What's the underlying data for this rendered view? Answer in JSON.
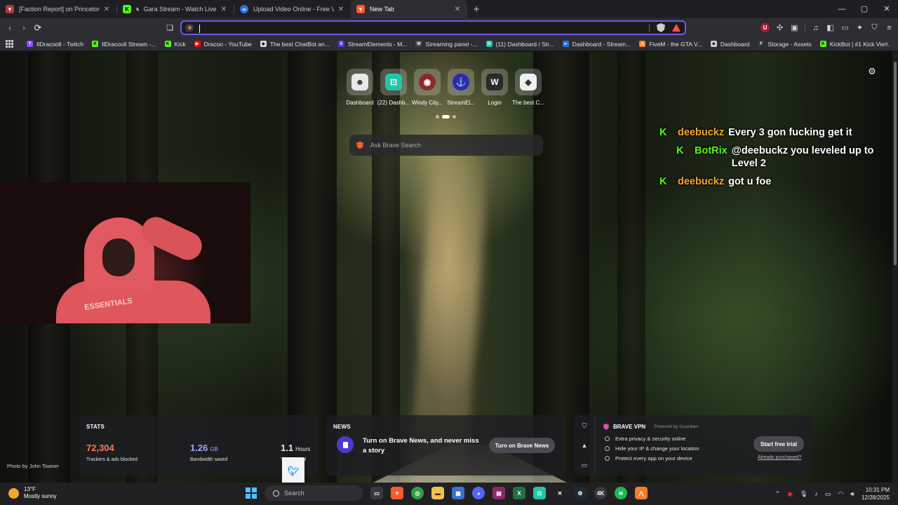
{
  "tabs": [
    {
      "title": "[Faction Report] on PrincetonBlock /",
      "favicon": "lion-icon",
      "color": "#b23b3b",
      "active": false,
      "muted": false
    },
    {
      "title": "Gara Stream - Watch Live on",
      "favicon": "kick-icon",
      "color": "#53fc18",
      "active": false,
      "muted": true
    },
    {
      "title": "Upload Video Online - Free Video H",
      "favicon": "upload-icon",
      "color": "#2f6fe0",
      "active": false,
      "muted": false
    },
    {
      "title": "New Tab",
      "favicon": "brave-icon",
      "color": "#ff5a2e",
      "active": true,
      "muted": false
    }
  ],
  "window_controls": {
    "minimize": "—",
    "maximize": "▢",
    "close": "✕"
  },
  "toolbar": {
    "back": "‹",
    "forward": "›",
    "reload": "⟳",
    "bookmark": "☐",
    "url_value": "",
    "url_placeholder": ""
  },
  "bookmarks": [
    {
      "label": "IlDracooll - Twitch",
      "icon": "twitch-icon",
      "color": "#9146ff"
    },
    {
      "label": "IlDracooll Stream -...",
      "icon": "kick-icon",
      "color": "#53fc18"
    },
    {
      "label": "Kick",
      "icon": "kick-icon",
      "color": "#53fc18"
    },
    {
      "label": "Dracoo - YouTube",
      "icon": "youtube-icon",
      "color": "#ff0000"
    },
    {
      "label": "The best ChatBot an...",
      "icon": "chatbot-icon",
      "color": "#dddddd"
    },
    {
      "label": "StreamElements - M...",
      "icon": "streamelements-icon",
      "color": "#4b3ad8"
    },
    {
      "label": "Streaming panel -...",
      "icon": "w-icon",
      "color": "#444444"
    },
    {
      "label": "(11) Dashboard / Str...",
      "icon": "dashboard-icon",
      "color": "#1fc7a8"
    },
    {
      "label": "Dashboard - Stream...",
      "icon": "stream-icon",
      "color": "#2f6fe0"
    },
    {
      "label": "FiveM - the GTA V...",
      "icon": "fivem-icon",
      "color": "#f27e2a"
    },
    {
      "label": "Dashboard",
      "icon": "bot-icon",
      "color": "#cccccc"
    },
    {
      "label": "Storage - Assets",
      "icon": "f-icon",
      "color": "#333333"
    },
    {
      "label": "KickBot | #1 Kick Vie...",
      "icon": "kick-icon",
      "color": "#53fc18"
    }
  ],
  "top_sites": [
    {
      "label": "Dashboard",
      "icon": "bot-icon",
      "color": "#e8e8e8",
      "glyph": "☻"
    },
    {
      "label": "(22) Dashb...",
      "icon": "dashboard-icon",
      "color": "#1fc7a8",
      "glyph": "⊡"
    },
    {
      "label": "Windy City...",
      "icon": "windy-city-icon",
      "color": "#8a2a2a",
      "glyph": "◉"
    },
    {
      "label": "StreamEl...",
      "icon": "streamelements-icon",
      "color": "#2b2bb0",
      "glyph": "⚓"
    },
    {
      "label": "Login",
      "icon": "w-icon",
      "color": "#2a2a2a",
      "glyph": "W"
    },
    {
      "label": "The best C...",
      "icon": "chatbot-icon",
      "color": "#f0f0f0",
      "glyph": "◆"
    }
  ],
  "search": {
    "placeholder": "Ask Brave Search"
  },
  "chat": [
    {
      "user": "deebuckz",
      "user_color": "#f5a623",
      "message": "Every 3 gon fucking get it",
      "indent": false
    },
    {
      "user": "BotRix",
      "user_color": "#53fc18",
      "message": "@deebuckz you leveled up to Level 2",
      "indent": true
    },
    {
      "user": "deebuckz",
      "user_color": "#f5a623",
      "message": "got u foe",
      "indent": false
    }
  ],
  "webcam": {
    "shirt_text": "ESSENTIALS"
  },
  "photo_credit": "Photo by John Towner",
  "stats": {
    "title": "STATS",
    "trackers": {
      "value": "72,304",
      "label": "Trackers & ads blocked",
      "color": "#ff7a4d"
    },
    "bandwidth": {
      "value": "1.26",
      "unit": "GB",
      "label": "Bandwidth saved",
      "color": "#9fa6ff"
    },
    "time": {
      "value": "1.1",
      "unit": "Hours",
      "label": "Time saved",
      "color": "#ffffff"
    }
  },
  "news": {
    "title": "NEWS",
    "text": "Turn on Brave News, and never miss a story",
    "button": "Turn on Brave News"
  },
  "vpn": {
    "title": "BRAVE VPN",
    "powered": "Powered by Guardian",
    "features": [
      "Extra privacy & security online",
      "Hide your IP & change your location",
      "Protect every app on your device"
    ],
    "button": "Start free trial",
    "link": "Already purchased?"
  },
  "taskbar": {
    "weather_temp": "13°F",
    "weather_desc": "Mostly sunny",
    "search_label": "Search",
    "apps": [
      {
        "name": "task-view-icon",
        "color": "#3a3a3e",
        "glyph": "▭"
      },
      {
        "name": "brave-icon",
        "color": "#ff5a2e",
        "glyph": "▼"
      },
      {
        "name": "chrome-icon",
        "color": "#2f9e44",
        "glyph": "◎"
      },
      {
        "name": "file-explorer-icon",
        "color": "#f2c14e",
        "glyph": "▬"
      },
      {
        "name": "store-icon",
        "color": "#3a6fd8",
        "glyph": "▦"
      },
      {
        "name": "discord-icon",
        "color": "#5865f2",
        "glyph": "◕"
      },
      {
        "name": "winrar-icon",
        "color": "#8a2a6a",
        "glyph": "▤"
      },
      {
        "name": "excel-icon",
        "color": "#1e7145",
        "glyph": "X"
      },
      {
        "name": "dashboard-icon",
        "color": "#1fc7a8",
        "glyph": "⊡"
      },
      {
        "name": "capcut-icon",
        "color": "#222222",
        "glyph": "✕"
      },
      {
        "name": "steam-icon",
        "color": "#1b2838",
        "glyph": "⚙"
      },
      {
        "name": "4k-icon",
        "color": "#3a3a3e",
        "glyph": "4K"
      },
      {
        "name": "spotify-icon",
        "color": "#1db954",
        "glyph": "≋"
      },
      {
        "name": "fivem-icon",
        "color": "#f27e2a",
        "glyph": "⋀"
      }
    ],
    "time": "10:31 PM",
    "date": "12/28/2025"
  }
}
